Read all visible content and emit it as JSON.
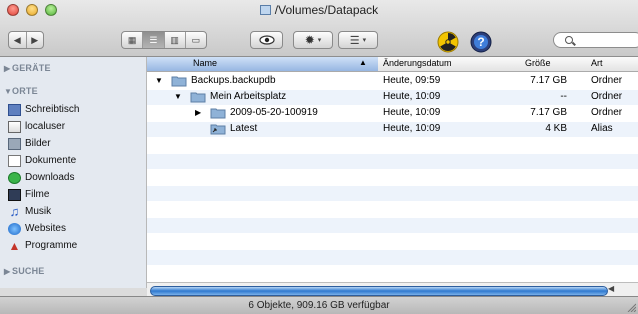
{
  "window": {
    "title": "/Volumes/Datapack",
    "status": "6 Objekte, 909.16 GB verfügbar"
  },
  "toolbar": {
    "back_icon": "chevron-left-icon",
    "forward_icon": "chevron-right-icon",
    "view_modes": [
      "icon-view",
      "list-view",
      "column-view",
      "coverflow-view"
    ],
    "quicklook_icon": "eye-icon",
    "action_icon": "gear-icon",
    "arrange_icon": "arrange-icon",
    "radiation_icon": "radiation-icon",
    "help_icon": "help-icon",
    "search_placeholder": ""
  },
  "sidebar": {
    "sections": [
      {
        "label": "GERÄTE",
        "expanded": false
      },
      {
        "label": "ORTE",
        "expanded": true
      },
      {
        "label": "SUCHE",
        "expanded": false
      }
    ],
    "items": [
      {
        "label": "Schreibtisch",
        "icon": "desktop-icon"
      },
      {
        "label": "localuser",
        "icon": "home-icon"
      },
      {
        "label": "Bilder",
        "icon": "pictures-icon"
      },
      {
        "label": "Dokumente",
        "icon": "documents-icon"
      },
      {
        "label": "Downloads",
        "icon": "downloads-icon"
      },
      {
        "label": "Filme",
        "icon": "movies-icon"
      },
      {
        "label": "Musik",
        "icon": "music-icon"
      },
      {
        "label": "Websites",
        "icon": "websites-icon"
      },
      {
        "label": "Programme",
        "icon": "applications-icon"
      }
    ]
  },
  "list": {
    "columns": [
      "Name",
      "Änderungsdatum",
      "Größe",
      "Art"
    ],
    "rows": [
      {
        "disclosure": "▼",
        "name": "Backups.backupdb",
        "date": "Heute, 09:59",
        "size": "7.17 GB",
        "kind": "Ordner",
        "icon": "folder-icon"
      },
      {
        "disclosure": "▼",
        "name": "Mein Arbeitsplatz",
        "date": "Heute, 10:09",
        "size": "--",
        "kind": "Ordner",
        "icon": "folder-icon"
      },
      {
        "disclosure": "▶",
        "name": "2009-05-20-100919",
        "date": "Heute, 10:09",
        "size": "7.17 GB",
        "kind": "Ordner",
        "icon": "folder-icon"
      },
      {
        "disclosure": "",
        "name": "Latest",
        "date": "Heute, 10:09",
        "size": "4 KB",
        "kind": "Alias",
        "icon": "alias-folder-icon"
      }
    ]
  },
  "colors": {
    "sidebar_bg": "#e4e9f0",
    "selected_header": "#97b6e2",
    "row_alt": "#edf3fb",
    "scroll_thumb": "#2f79d0"
  }
}
